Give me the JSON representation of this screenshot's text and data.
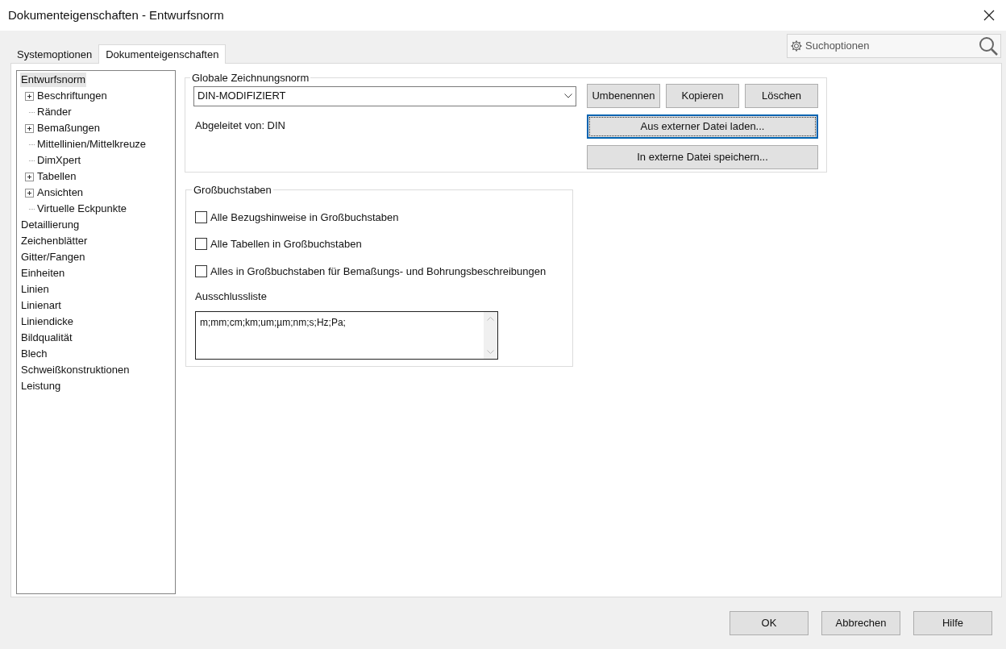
{
  "window": {
    "title": "Dokumenteigenschaften - Entwurfsnorm"
  },
  "search": {
    "placeholder": "Suchoptionen"
  },
  "tabs": [
    {
      "label": "Systemoptionen",
      "selected": false
    },
    {
      "label": "Dokumenteigenschaften",
      "selected": true
    }
  ],
  "tree": [
    {
      "label": "Entwurfsnorm",
      "selected": true,
      "children": [
        {
          "label": "Beschriftungen",
          "selected": false,
          "expanded": false
        },
        {
          "label": "Ränder",
          "selected": false
        },
        {
          "label": "Bemaßungen",
          "selected": false,
          "expanded": false
        },
        {
          "label": "Mittellinien/Mittelkreuze",
          "selected": false
        },
        {
          "label": "DimXpert",
          "selected": false
        },
        {
          "label": "Tabellen",
          "selected": false,
          "expanded": false
        },
        {
          "label": "Ansichten",
          "selected": false,
          "expanded": false
        },
        {
          "label": "Virtuelle Eckpunkte",
          "selected": false
        }
      ]
    },
    {
      "label": "Detaillierung",
      "selected": false
    },
    {
      "label": "Zeichenblätter",
      "selected": false
    },
    {
      "label": "Gitter/Fangen",
      "selected": false
    },
    {
      "label": "Einheiten",
      "selected": false
    },
    {
      "label": "Linien",
      "selected": false
    },
    {
      "label": "Linienart",
      "selected": false
    },
    {
      "label": "Liniendicke",
      "selected": false
    },
    {
      "label": "Bildqualität",
      "selected": false
    },
    {
      "label": "Blech",
      "selected": false
    },
    {
      "label": "Schweißkonstruktionen",
      "selected": false
    },
    {
      "label": "Leistung",
      "selected": false
    }
  ],
  "global_standard": {
    "title": "Globale Zeichnungsnorm",
    "value": "DIN-MODIFIZIERT",
    "derived_from": "Abgeleitet von: DIN",
    "buttons": [
      "Umbenennen",
      "Kopieren",
      "Löschen"
    ],
    "wide_buttons": [
      {
        "label": "Aus externer Datei laden...",
        "focused": true
      },
      {
        "label": "In externe Datei speichern...",
        "focused": false
      }
    ]
  },
  "uppercase": {
    "title": "Großbuchstaben",
    "options": [
      {
        "label": "Alle Bezugshinweise in Großbuchstaben",
        "checked": false
      },
      {
        "label": "Alle Tabellen in Großbuchstaben",
        "checked": false
      },
      {
        "label": "Alles in Großbuchstaben für Bemaßungs- und Bohrungsbeschreibungen",
        "checked": false
      }
    ],
    "exclusion_label": "Ausschlussliste",
    "exclusion_value": "m;mm;cm;km;um;µm;nm;s;Hz;Pa;"
  },
  "footer_buttons": [
    "OK",
    "Abbrechen",
    "Hilfe"
  ]
}
